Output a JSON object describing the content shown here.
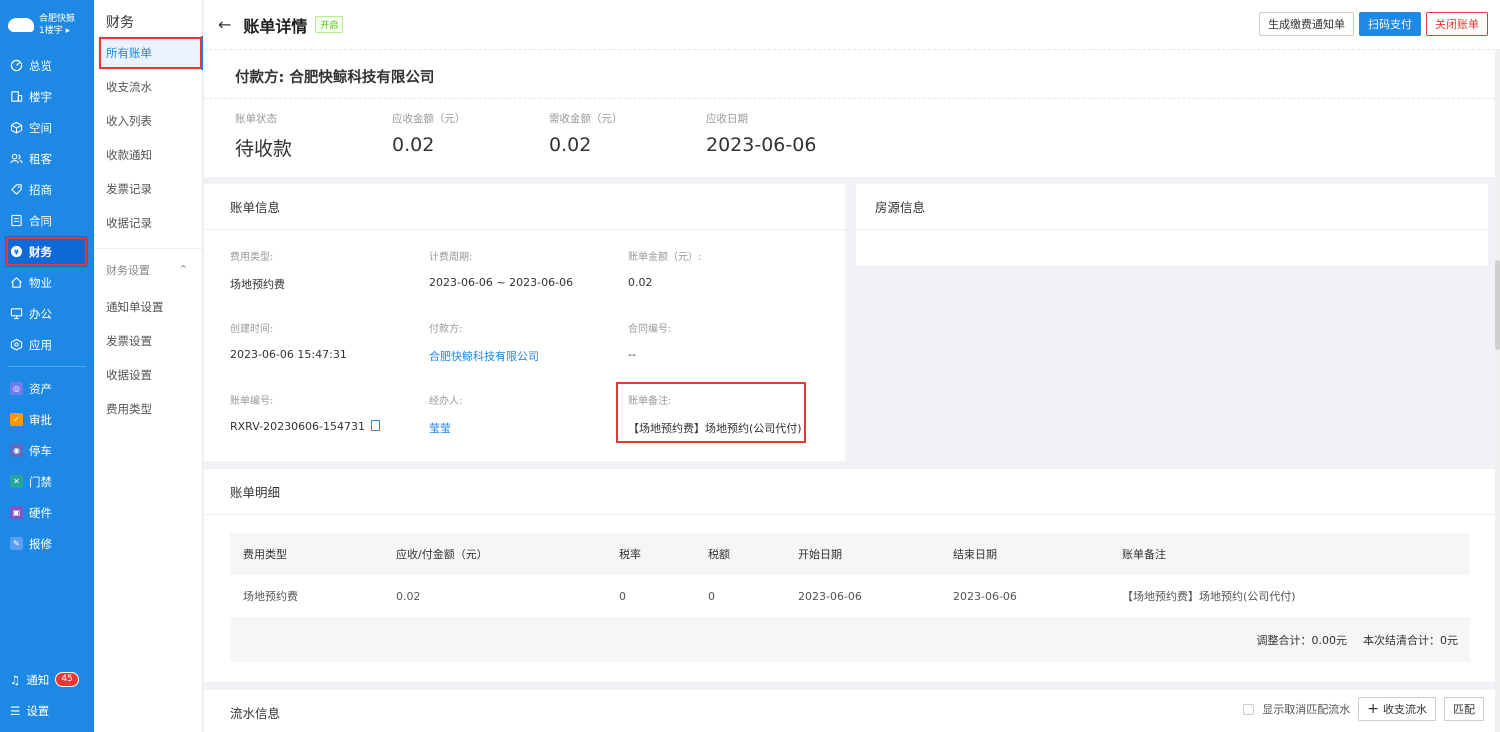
{
  "sidebar": {
    "brand_name": "合肥快鲸",
    "building": "1楼宇",
    "items": [
      {
        "label": "总览",
        "icon": "dashboard-icon"
      },
      {
        "label": "楼宇",
        "icon": "building-icon"
      },
      {
        "label": "空间",
        "icon": "cube-icon"
      },
      {
        "label": "租客",
        "icon": "users-icon"
      },
      {
        "label": "招商",
        "icon": "tag-icon"
      },
      {
        "label": "合同",
        "icon": "document-icon"
      },
      {
        "label": "财务",
        "icon": "money-icon"
      },
      {
        "label": "物业",
        "icon": "home-icon"
      },
      {
        "label": "办公",
        "icon": "monitor-icon"
      },
      {
        "label": "应用",
        "icon": "app-icon"
      }
    ],
    "apps": [
      {
        "label": "资产",
        "color": "#6f7cf0"
      },
      {
        "label": "审批",
        "color": "#ff9800"
      },
      {
        "label": "停车",
        "color": "#5c6bc0"
      },
      {
        "label": "门禁",
        "color": "#26a69a"
      },
      {
        "label": "硬件",
        "color": "#7e57c2"
      },
      {
        "label": "报修",
        "color": "#5c9ded"
      }
    ],
    "notice_label": "通知",
    "notice_count": "45",
    "settings_label": "设置"
  },
  "subnav": {
    "title": "财务",
    "items": [
      "所有账单",
      "收支流水",
      "收入列表",
      "收款通知",
      "发票记录",
      "收据记录"
    ],
    "group_label": "财务设置",
    "group_items": [
      "通知单设置",
      "发票设置",
      "收据设置",
      "费用类型"
    ]
  },
  "header": {
    "title": "账单详情",
    "status_tag": "开启",
    "btn_notice": "生成缴费通知单",
    "btn_scan": "扫码支付",
    "btn_close": "关闭账单"
  },
  "payer": "付款方: 合肥快鲸科技有限公司",
  "summary": [
    {
      "label": "账单状态",
      "value": "待收款"
    },
    {
      "label": "应收金额（元）",
      "value": "0.02"
    },
    {
      "label": "需收金额（元）",
      "value": "0.02"
    },
    {
      "label": "应收日期",
      "value": "2023-06-06"
    }
  ],
  "bill_info": {
    "title": "账单信息",
    "fields": [
      {
        "label": "费用类型:",
        "value": "场地预约费"
      },
      {
        "label": "计费周期:",
        "value": "2023-06-06 ~ 2023-06-06"
      },
      {
        "label": "账单金额（元）:",
        "value": "0.02"
      },
      {
        "label": "创建时间:",
        "value": "2023-06-06 15:47:31"
      },
      {
        "label": "付款方:",
        "value": "合肥快鲸科技有限公司"
      },
      {
        "label": "合同编号:",
        "value": "--"
      },
      {
        "label": "账单编号:",
        "value": "RXRV-20230606-154731"
      },
      {
        "label": "经办人:",
        "value": "莹莹"
      },
      {
        "label": "账单备注:",
        "value": "【场地预约费】场地预约(公司代付)"
      }
    ]
  },
  "room_info": {
    "title": "房源信息"
  },
  "detail": {
    "title": "账单明细",
    "columns": [
      "费用类型",
      "应收/付金额（元）",
      "税率",
      "税额",
      "开始日期",
      "结束日期",
      "账单备注"
    ],
    "rows": [
      [
        "场地预约费",
        "0.02",
        "0",
        "0",
        "2023-06-06",
        "2023-06-06",
        "【场地预约费】场地预约(公司代付)"
      ]
    ],
    "adjust_total": "调整合计：0.00元",
    "settle_total": "本次结清合计：0元"
  },
  "flow": {
    "title": "流水信息",
    "show_cancelled": "显示取消匹配流水",
    "btn_add": "收支流水",
    "btn_match": "匹配"
  }
}
